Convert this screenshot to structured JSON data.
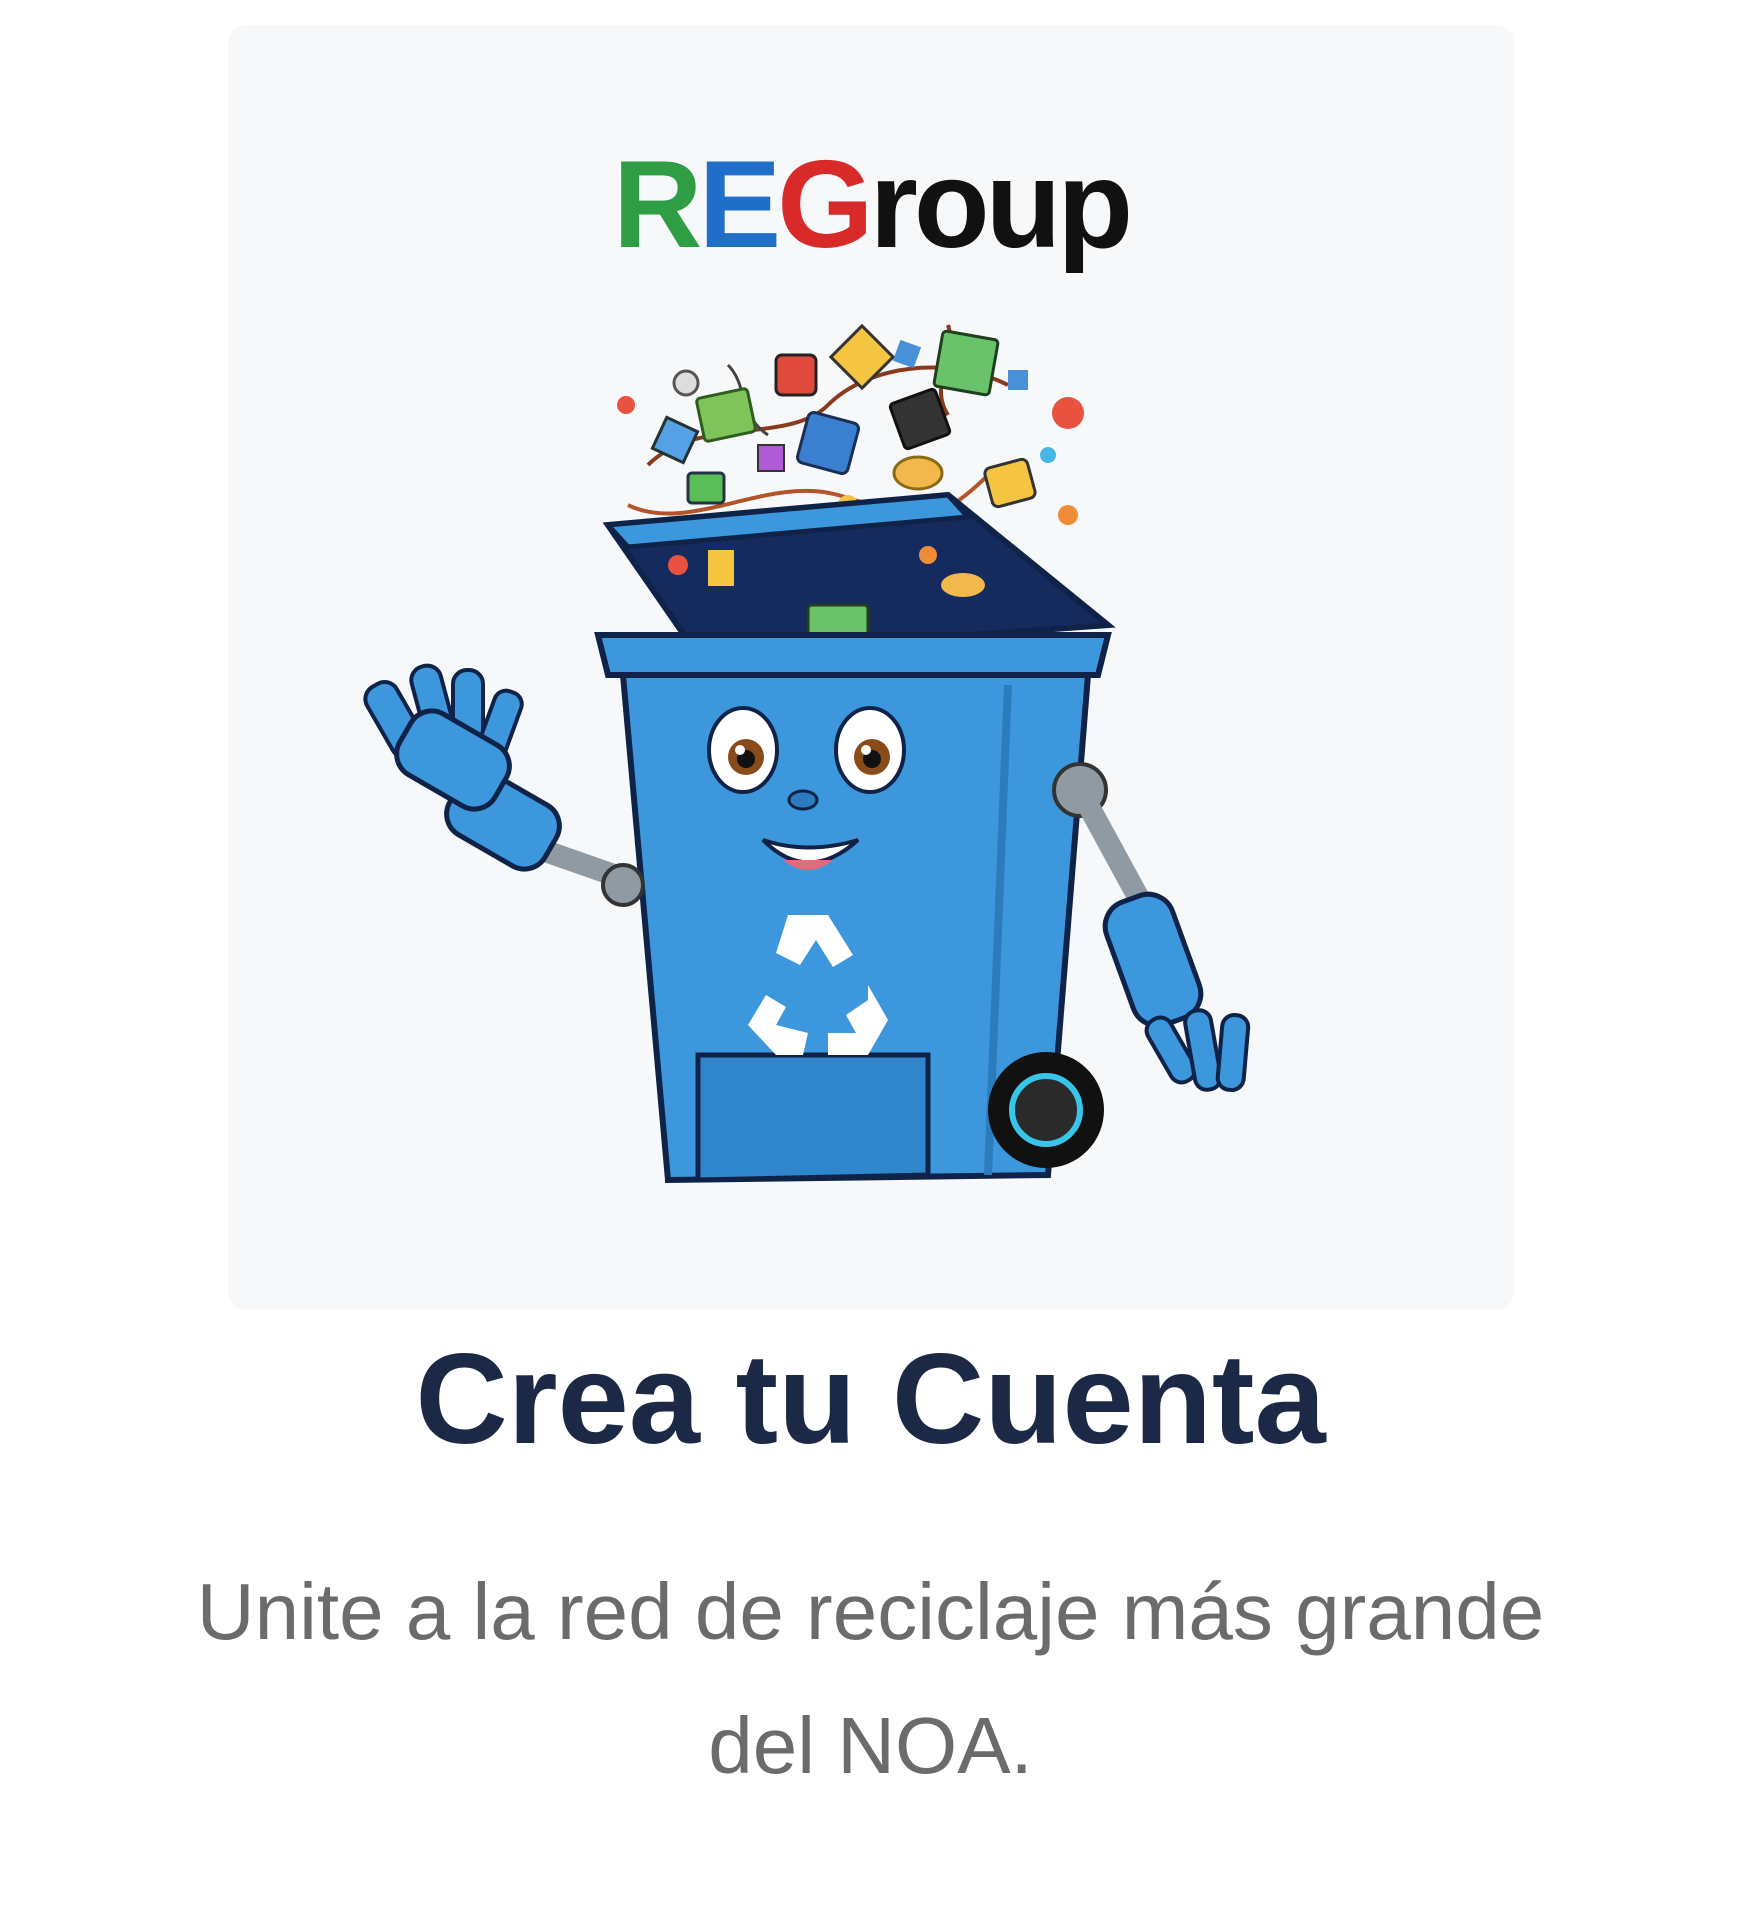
{
  "logo": {
    "letters": [
      {
        "text": "R",
        "color": "#2e9d43"
      },
      {
        "text": "E",
        "color": "#1f6fc8"
      },
      {
        "text": "G",
        "color": "#d92a2a"
      },
      {
        "text": "roup",
        "color": "#111111"
      }
    ]
  },
  "heading": {
    "title": "Crea tu Cuenta",
    "subtitle": "Unite a la red de reciclaje más grande del NOA."
  },
  "illustration": {
    "icon": "recycle-bin-robot-mascot-icon"
  },
  "colors": {
    "title": "#1b2947",
    "subtitle": "#6b6b6b",
    "bin_blue": "#3d97dc",
    "background": "#ffffff"
  }
}
